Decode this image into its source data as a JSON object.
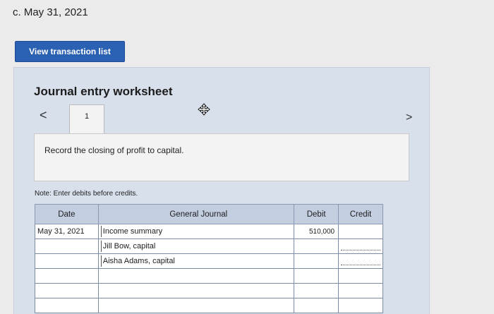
{
  "part_heading": "c. May 31, 2021",
  "view_button_label": "View transaction list",
  "worksheet": {
    "title": "Journal entry worksheet",
    "prev_glyph": "<",
    "next_glyph": ">",
    "tab_number": "1",
    "instruction": "Record the closing of profit to capital.",
    "note": "Note: Enter debits before credits."
  },
  "journal": {
    "headers": {
      "date": "Date",
      "general_journal": "General Journal",
      "debit": "Debit",
      "credit": "Credit"
    },
    "rows": [
      {
        "date": "May 31, 2021",
        "account": "Income summary",
        "debit": "510,000",
        "credit": ""
      },
      {
        "date": "",
        "account": "Jill Bow, capital",
        "debit": "",
        "credit": ""
      },
      {
        "date": "",
        "account": "Aisha Adams, capital",
        "debit": "",
        "credit": ""
      },
      {
        "date": "",
        "account": "",
        "debit": "",
        "credit": ""
      },
      {
        "date": "",
        "account": "",
        "debit": "",
        "credit": ""
      },
      {
        "date": "",
        "account": "",
        "debit": "",
        "credit": ""
      }
    ]
  }
}
